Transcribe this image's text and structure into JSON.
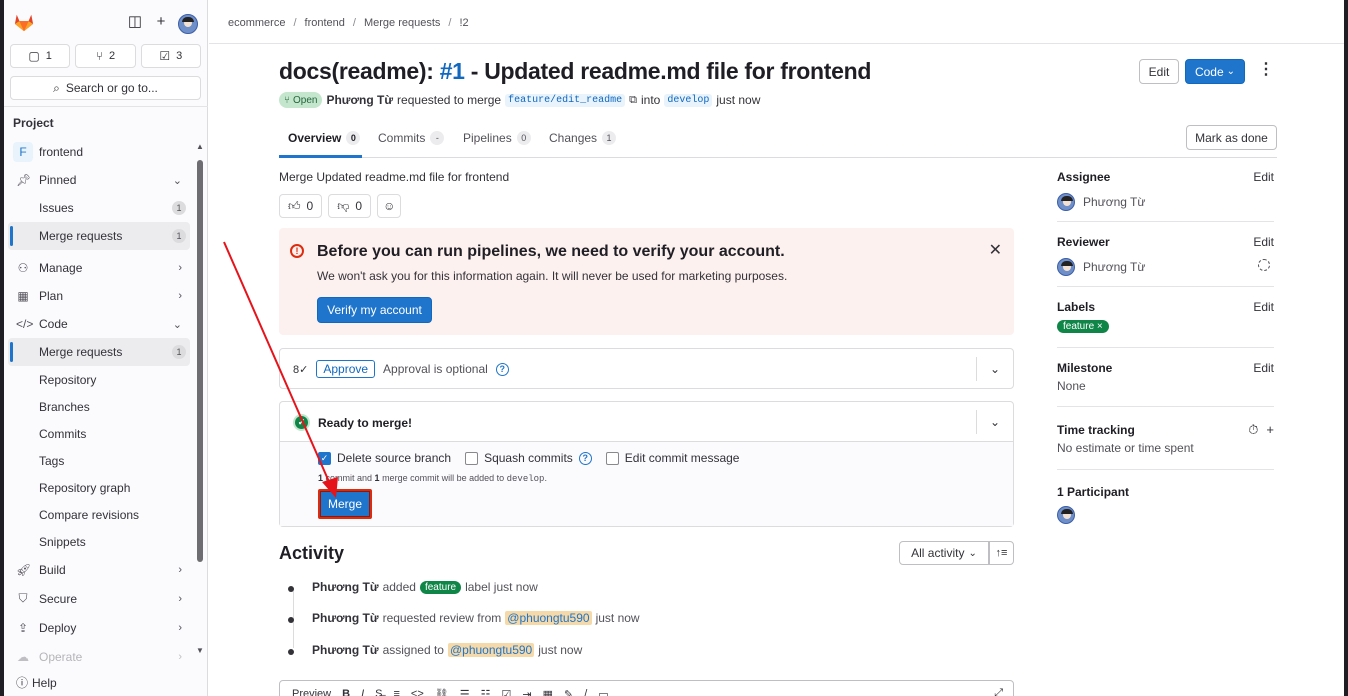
{
  "breadcrumb": [
    "ecommerce",
    "frontend",
    "Merge requests",
    "!2"
  ],
  "sidebar": {
    "counts": [
      {
        "icon": "issues-icon",
        "value": "1"
      },
      {
        "icon": "merge-request-icon",
        "value": "2"
      },
      {
        "icon": "todo-icon",
        "value": "3"
      }
    ],
    "search_placeholder": "Search or go to...",
    "section_title": "Project",
    "project_name": "frontend",
    "project_initial": "F",
    "items": [
      {
        "label": "Pinned",
        "icon": "pin-icon"
      },
      {
        "label": "Issues",
        "badge": "1"
      },
      {
        "label": "Merge requests",
        "badge": "1"
      },
      {
        "label": "Manage",
        "icon": "users-icon"
      },
      {
        "label": "Plan",
        "icon": "calendar-icon"
      },
      {
        "label": "Code",
        "icon": "code-icon"
      },
      {
        "label": "Merge requests",
        "badge": "1"
      },
      {
        "label": "Repository"
      },
      {
        "label": "Branches"
      },
      {
        "label": "Commits"
      },
      {
        "label": "Tags"
      },
      {
        "label": "Repository graph"
      },
      {
        "label": "Compare revisions"
      },
      {
        "label": "Snippets"
      },
      {
        "label": "Build",
        "icon": "rocket-icon"
      },
      {
        "label": "Secure",
        "icon": "shield-icon"
      },
      {
        "label": "Deploy",
        "icon": "deploy-icon"
      },
      {
        "label": "Operate",
        "icon": "operate-icon"
      }
    ],
    "help": "Help"
  },
  "mr": {
    "title_prefix": "docs(readme): ",
    "title_num": "#1",
    "title_suffix": " - Updated readme.md file for frontend",
    "edit": "Edit",
    "code": "Code",
    "status": "Open",
    "author": "Phương Từ",
    "requested": "requested to merge",
    "source_branch": "feature/edit_readme",
    "into": "into",
    "target_branch": "develop",
    "when": "just now",
    "mark_done": "Mark as done",
    "tabs": [
      {
        "label": "Overview",
        "count": "0"
      },
      {
        "label": "Commits",
        "count": "-"
      },
      {
        "label": "Pipelines",
        "count": "0"
      },
      {
        "label": "Changes",
        "count": "1"
      }
    ],
    "description": "Merge Updated readme.md file for frontend",
    "thumbs_up": "0",
    "thumbs_down": "0"
  },
  "alert": {
    "title": "Before you can run pipelines, we need to verify your account.",
    "body": "We won't ask you for this information again. It will never be used for marketing purposes.",
    "button": "Verify my account"
  },
  "approval": {
    "button": "Approve",
    "text": "Approval is optional"
  },
  "merge": {
    "ready": "Ready to merge!",
    "delete_source": "Delete source branch",
    "squash": "Squash commits",
    "edit_message": "Edit commit message",
    "note_a": "1",
    "note_b": " commit and ",
    "note_c": "1",
    "note_d": " merge commit will be added to ",
    "note_branch": "develop",
    "note_end": ".",
    "button": "Merge"
  },
  "activity": {
    "title": "Activity",
    "filter": "All activity",
    "items": [
      {
        "who": "Phương Từ",
        "pre": "added",
        "pill": "feature",
        "post": "label just now"
      },
      {
        "who": "Phương Từ",
        "pre": "requested review from",
        "mention": "@phuongtu590",
        "post": "just now"
      },
      {
        "who": "Phương Từ",
        "pre": "assigned to",
        "mention": "@phuongtu590",
        "post": "just now"
      }
    ],
    "editor_tab": "Preview"
  },
  "right": {
    "edit": "Edit",
    "assignee_title": "Assignee",
    "assignee": "Phương Từ",
    "reviewer_title": "Reviewer",
    "reviewer": "Phương Từ",
    "labels_title": "Labels",
    "label": "feature",
    "milestone_title": "Milestone",
    "milestone": "None",
    "time_title": "Time tracking",
    "time_value": "No estimate or time spent",
    "participants": "1 Participant"
  },
  "colors": {
    "primary": "#1f75cb",
    "success": "#108548",
    "danger": "#dd2b0e",
    "alert_bg": "#fdf1ef"
  }
}
